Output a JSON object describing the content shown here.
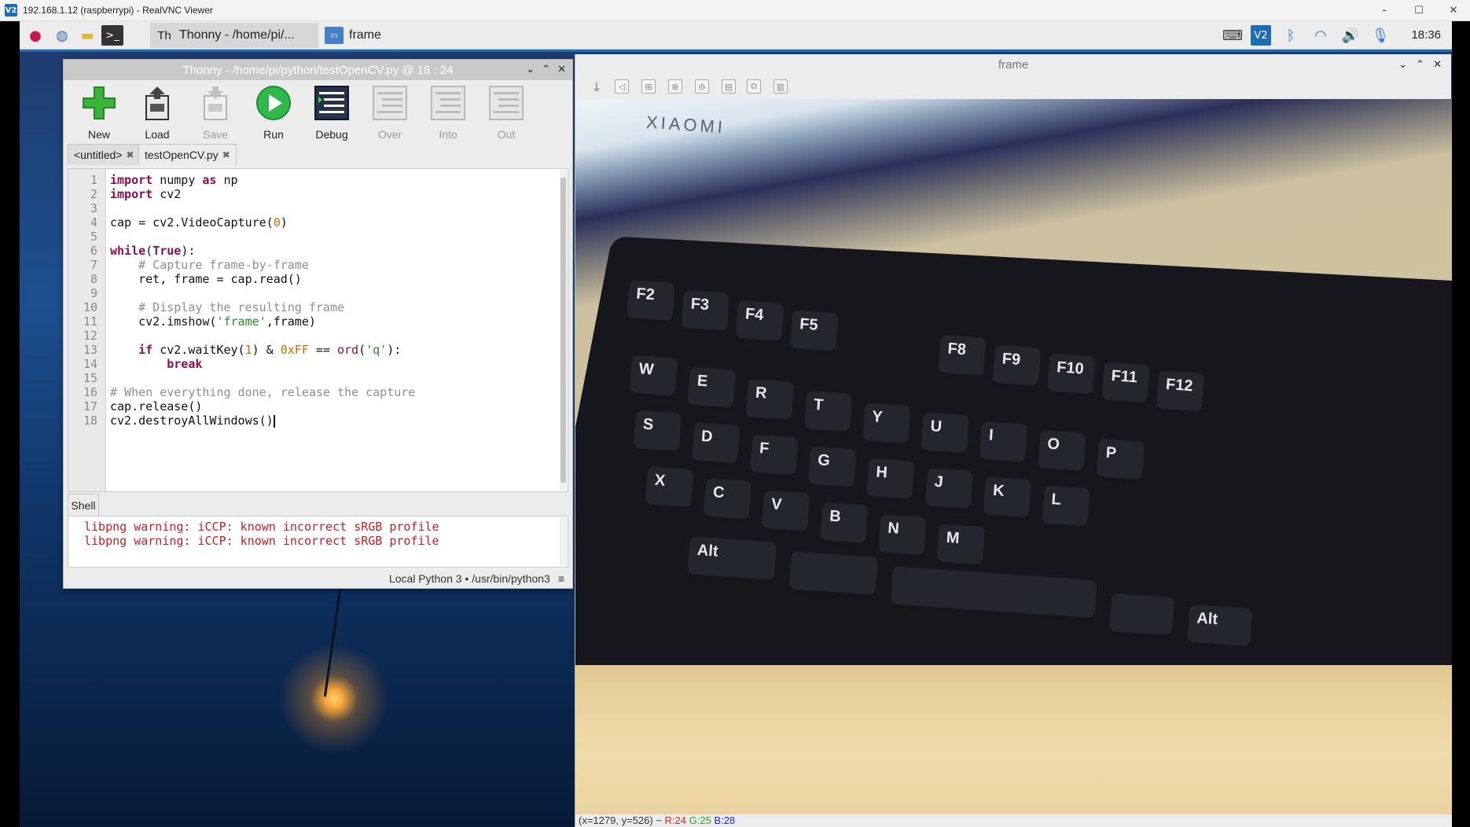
{
  "vnc": {
    "title": "192.168.1.12 (raspberrypi) - RealVNC Viewer",
    "app_icon": "V2",
    "controls": {
      "minimize": "–",
      "maximize": "☐",
      "close": "✕"
    }
  },
  "taskbar": {
    "tasks": [
      {
        "label": "Thonny  -  /home/pi/...",
        "icon": "thonny-icon"
      },
      {
        "label": "frame",
        "icon": "window-icon"
      }
    ],
    "clock": "18:36"
  },
  "thonny": {
    "title": "Thonny  -  /home/pi/python/testOpenCV.py  @  18 : 24",
    "toolbar": [
      {
        "label": "New",
        "enabled": true
      },
      {
        "label": "Load",
        "enabled": true
      },
      {
        "label": "Save",
        "enabled": false
      },
      {
        "label": "Run",
        "enabled": true
      },
      {
        "label": "Debug",
        "enabled": true
      },
      {
        "label": "Over",
        "enabled": false
      },
      {
        "label": "Into",
        "enabled": false
      },
      {
        "label": "Out",
        "enabled": false
      }
    ],
    "tabs": [
      {
        "label": "<untitled>"
      },
      {
        "label": "testOpenCV.py"
      }
    ],
    "line_numbers": [
      "1",
      "2",
      "3",
      "4",
      "5",
      "6",
      "7",
      "8",
      "9",
      "10",
      "11",
      "12",
      "13",
      "14",
      "15",
      "16",
      "17",
      "18"
    ],
    "code": [
      "import numpy as np",
      "import cv2",
      "",
      "cap = cv2.VideoCapture(0)",
      "",
      "while(True):",
      "    # Capture frame-by-frame",
      "    ret, frame = cap.read()",
      "",
      "    # Display the resulting frame",
      "    cv2.imshow('frame',frame)",
      "",
      "    if cv2.waitKey(1) & 0xFF == ord('q'):",
      "        break",
      "",
      "# When everything done, release the capture",
      "cap.release()",
      "cv2.destroyAllWindows()"
    ],
    "shell_tab": "Shell",
    "shell_lines": [
      "libpng warning: iCCP: known incorrect sRGB profile",
      "libpng warning: iCCP: known incorrect sRGB profile"
    ],
    "status": "Local Python 3  •  /usr/bin/python3",
    "status_menu": "≡"
  },
  "frame_window": {
    "title": "frame",
    "monitor_brand": "XIAOMI",
    "pixel_info": {
      "coords": "(x=1279, y=526) ~",
      "r": "R:24",
      "g": "G:25",
      "b": "B:28"
    }
  },
  "colors": {
    "keyword": "#8a0f51",
    "comment": "#8e8e8e",
    "string": "#2b8a2b",
    "number": "#d46a00",
    "shell_error": "#c42020",
    "accent": "#1c6db5"
  }
}
